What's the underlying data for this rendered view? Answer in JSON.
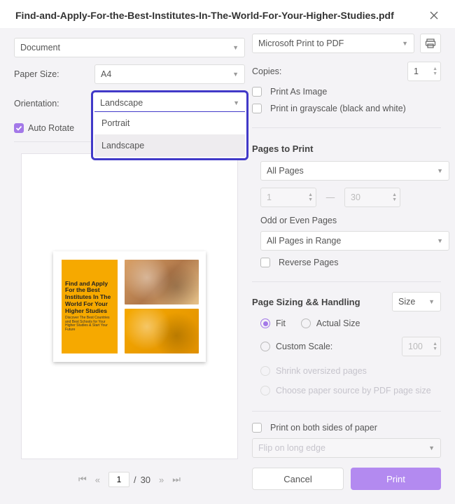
{
  "header": {
    "title": "Find-and-Apply-For-the-Best-Institutes-In-The-World-For-Your-Higher-Studies.pdf"
  },
  "left": {
    "mode": "Document",
    "paperSizeLabel": "Paper Size:",
    "paperSize": "A4",
    "orientationLabel": "Orientation:",
    "orientation": {
      "selected": "Landscape",
      "options": [
        "Portrait",
        "Landscape"
      ]
    },
    "autoRotate": "Auto Rotate",
    "preview": {
      "text": "Find and Apply For the Best Institutes In The World For Your Higher Studies",
      "sub": "Discover The Best Countries and Best Schools for Your Higher Studies & Start Your Future"
    },
    "pager": {
      "current": "1",
      "sep": "/",
      "total": "30"
    }
  },
  "right": {
    "printer": "Microsoft Print to PDF",
    "copiesLabel": "Copies:",
    "copies": "1",
    "printAsImage": "Print As Image",
    "printGrayscale": "Print in grayscale (black and white)",
    "pagesToPrint": {
      "title": "Pages to Print",
      "mode": "All Pages",
      "from": "1",
      "to": "30",
      "oddEvenLabel": "Odd or Even Pages",
      "oddEven": "All Pages in Range",
      "reverse": "Reverse Pages"
    },
    "sizing": {
      "title": "Page Sizing && Handling",
      "sizeDropdown": "Size",
      "fit": "Fit",
      "actual": "Actual Size",
      "customScale": "Custom Scale:",
      "customScaleValue": "100",
      "shrink": "Shrink oversized pages",
      "choosePaper": "Choose paper source by PDF page size"
    },
    "duplex": "Print on both sides of paper",
    "flip": "Flip on long edge",
    "cancel": "Cancel",
    "print": "Print"
  }
}
